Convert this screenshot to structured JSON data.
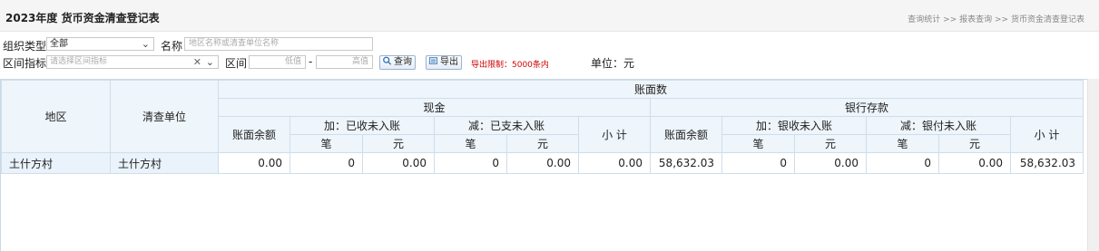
{
  "header": {
    "title": "2023年度 货币资金清查登记表",
    "breadcrumb": [
      "查询统计",
      "报表查询",
      "货币资金清查登记表"
    ],
    "breadcrumb_sep": ">>"
  },
  "filters": {
    "org_type_label": "组织类型",
    "org_type_value": "全部",
    "name_label": "名称",
    "name_placeholder": "地区名称或清查单位名称",
    "range_indicator_label": "区间指标",
    "range_indicator_placeholder": "请选择区间指标",
    "range_label": "区间",
    "low_placeholder": "低值",
    "range_dash": "-",
    "high_placeholder": "高值",
    "query_button": "查询",
    "export_button": "导出",
    "export_limit_note": "导出限制：5000条内",
    "unit_label": "单位：元"
  },
  "table": {
    "headers": {
      "region": "地区",
      "unit": "清查单位",
      "book_amount": "账面数",
      "cash": "现金",
      "bank": "银行存款",
      "balance": "账面余额",
      "add_received": "加：已收未入账",
      "sub_paid": "减：已支未入账",
      "add_bank_received": "加：银收未入账",
      "sub_bank_paid": "减：银付未入账",
      "count": "笔",
      "yuan": "元",
      "subtotal": "小 计"
    },
    "rows": [
      {
        "region": "土什方村",
        "unit": "土什方村",
        "cash_balance": "0.00",
        "cash_add_count": "0",
        "cash_add_yuan": "0.00",
        "cash_sub_count": "0",
        "cash_sub_yuan": "0.00",
        "cash_subtotal": "0.00",
        "bank_balance": "58,632.03",
        "bank_add_count": "0",
        "bank_add_yuan": "0.00",
        "bank_sub_count": "0",
        "bank_sub_yuan": "0.00",
        "bank_subtotal": "58,632.03"
      }
    ]
  }
}
